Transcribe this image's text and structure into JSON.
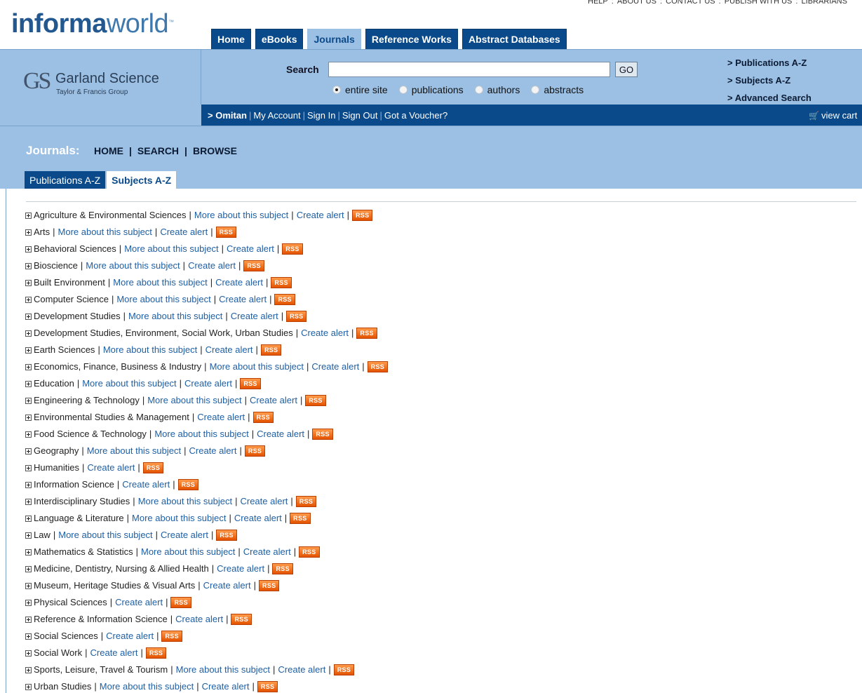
{
  "top_links": [
    "HELP",
    "ABOUT US",
    "CONTACT US",
    "PUBLISH WITH US",
    "LIBRARIANS"
  ],
  "logo": {
    "bold": "informa",
    "light": "world",
    "tm": "™"
  },
  "main_tabs": [
    {
      "label": "Home"
    },
    {
      "label": "eBooks"
    },
    {
      "label": "Journals"
    },
    {
      "label": "Reference Works"
    },
    {
      "label": "Abstract Databases"
    }
  ],
  "brand": {
    "mark": "GS",
    "name": "Garland Science",
    "group": "Taylor & Francis Group"
  },
  "search": {
    "label": "Search",
    "value": "",
    "go_label": "GO",
    "options": [
      "entire site",
      "publications",
      "authors",
      "abstracts"
    ],
    "selected": "entire site"
  },
  "quick_links": [
    "> Publications A-Z",
    "> Subjects A-Z",
    "> Advanced Search"
  ],
  "account": {
    "arrow": ">",
    "user": "Omitan",
    "links": [
      "My Account",
      "Sign In",
      "Sign Out",
      "Got a Voucher?"
    ],
    "cart_label": "view cart"
  },
  "journals": {
    "title": "Journals:",
    "nav": [
      "HOME",
      "SEARCH",
      "BROWSE"
    ],
    "tabs": [
      "Publications A-Z",
      "Subjects A-Z"
    ]
  },
  "link_labels": {
    "more": "More about this subject",
    "alert": "Create alert",
    "rss": "RSS"
  },
  "subjects": [
    {
      "name": "Agriculture & Environmental Sciences",
      "more": true
    },
    {
      "name": "Arts",
      "more": true
    },
    {
      "name": "Behavioral Sciences",
      "more": true
    },
    {
      "name": "Bioscience",
      "more": true
    },
    {
      "name": "Built Environment",
      "more": true
    },
    {
      "name": "Computer Science",
      "more": true
    },
    {
      "name": "Development Studies",
      "more": true
    },
    {
      "name": "Development Studies, Environment, Social Work, Urban Studies",
      "more": false
    },
    {
      "name": "Earth Sciences",
      "more": true
    },
    {
      "name": "Economics, Finance, Business & Industry",
      "more": true
    },
    {
      "name": "Education",
      "more": true
    },
    {
      "name": "Engineering & Technology",
      "more": true
    },
    {
      "name": "Environmental Studies & Management",
      "more": false
    },
    {
      "name": "Food Science & Technology",
      "more": true
    },
    {
      "name": "Geography",
      "more": true
    },
    {
      "name": "Humanities",
      "more": false
    },
    {
      "name": "Information Science",
      "more": false
    },
    {
      "name": "Interdisciplinary Studies",
      "more": true
    },
    {
      "name": "Language & Literature",
      "more": true
    },
    {
      "name": "Law",
      "more": true
    },
    {
      "name": "Mathematics & Statistics",
      "more": true
    },
    {
      "name": "Medicine, Dentistry, Nursing & Allied Health",
      "more": false
    },
    {
      "name": "Museum, Heritage Studies & Visual Arts",
      "more": false
    },
    {
      "name": "Physical Sciences",
      "more": false
    },
    {
      "name": "Reference & Information Science",
      "more": false
    },
    {
      "name": "Social Sciences",
      "more": false
    },
    {
      "name": "Social Work",
      "more": false
    },
    {
      "name": "Sports, Leisure, Travel & Tourism",
      "more": true
    },
    {
      "name": "Urban Studies",
      "more": true
    }
  ],
  "colors": {
    "nav_blue": "#0a4a8a",
    "band_blue": "#9cc0e4",
    "link_blue": "#1f5fa3",
    "rss_orange": "#f06a1a"
  }
}
